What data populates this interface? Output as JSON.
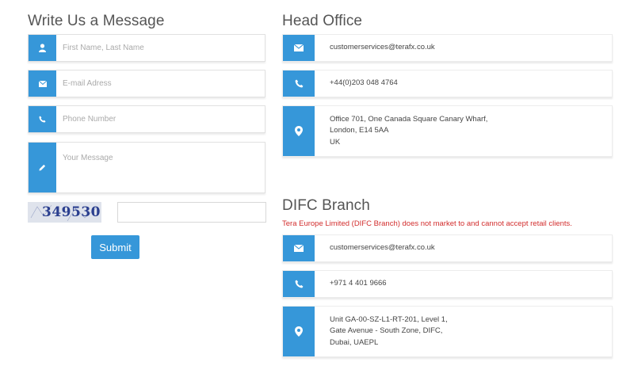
{
  "form": {
    "title": "Write Us a Message",
    "name_placeholder": "First Name, Last Name",
    "email_placeholder": "E-mail Adress",
    "phone_placeholder": "Phone Number",
    "message_placeholder": "Your Message",
    "captcha_text": "349530",
    "captcha_value": "",
    "submit_label": "Submit"
  },
  "head_office": {
    "title": "Head Office",
    "email": "customerservices@terafx.co.uk",
    "phone": "+44(0)203 048 4764",
    "address": [
      "Office 701, One Canada Square Canary Wharf,",
      "London, E14 5AA",
      "UK"
    ]
  },
  "difc": {
    "title": "DIFC Branch",
    "notice": "Tera Europe Limited (DIFC Branch) does not market to and cannot accept retail clients.",
    "email": "customerservices@terafx.co.uk",
    "phone": "+971 4 401 9666",
    "address": [
      "Unit GA-00-SZ-L1-RT-201, Level 1,",
      "Gate Avenue - South Zone, DIFC,",
      "Dubai, UAEPL"
    ]
  },
  "colors": {
    "accent": "#3697d9",
    "notice": "#d22d2d"
  },
  "icons": {
    "name": "user-icon",
    "email": "envelope-icon",
    "phone": "phone-icon",
    "message": "pencil-icon",
    "address": "map-marker-icon"
  }
}
